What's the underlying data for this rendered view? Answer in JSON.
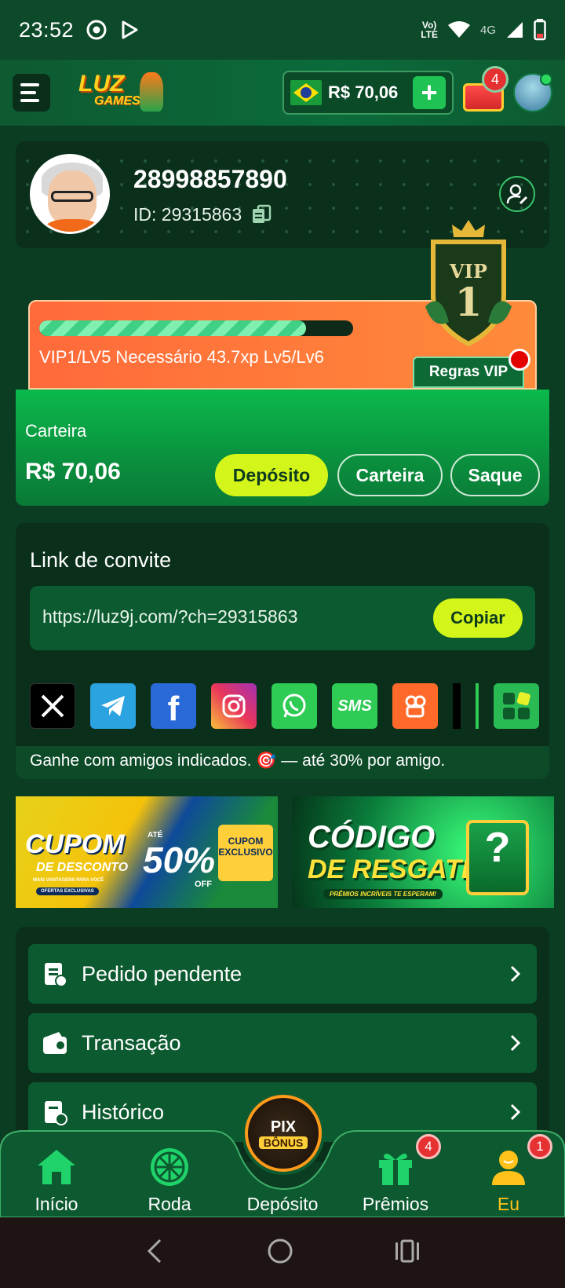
{
  "status_bar": {
    "time": "23:52",
    "net_label": "Vo)\nLTE",
    "net_type": "4G",
    "icons": [
      "chrome-icon",
      "play-store-icon",
      "volte-icon",
      "wifi-icon",
      "signal-icon",
      "battery-icon"
    ]
  },
  "header": {
    "logo_line1": "LUZ",
    "logo_line2": "GAMES",
    "balance": "R$ 70,06",
    "plus": "+",
    "chest_badge": "4",
    "flag": "brazil-flag"
  },
  "profile": {
    "username": "28998857890",
    "user_id": "ID: 29315863"
  },
  "vip": {
    "progress_fraction": 0.85,
    "level_text": "VIP1/LV5  Necessário 43.7xp Lv5/Lv6",
    "badge_label": "VIP",
    "badge_level": "1",
    "rules_label": "Regras VIP"
  },
  "wallet": {
    "label": "Carteira",
    "amount": "R$ 70,06",
    "deposit_label": "Depósito",
    "wallet_label": "Carteira",
    "withdraw_label": "Saque"
  },
  "invite": {
    "title": "Link de convite",
    "link": "https://luz9j.com/?ch=29315863",
    "copy_label": "Copiar",
    "social": [
      {
        "name": "x-icon",
        "label": "X"
      },
      {
        "name": "telegram-icon",
        "label": ""
      },
      {
        "name": "facebook-icon",
        "label": "f"
      },
      {
        "name": "instagram-icon",
        "label": ""
      },
      {
        "name": "whatsapp-icon",
        "label": ""
      },
      {
        "name": "sms-icon",
        "label": "SMS"
      },
      {
        "name": "kwai-icon",
        "label": ""
      },
      {
        "name": "tiktok-icon",
        "label": ""
      },
      {
        "name": "line-icon",
        "label": ""
      },
      {
        "name": "more-apps-icon",
        "label": ""
      }
    ],
    "note": "Ganhe com amigos indicados. 🎯 — até 30% por amigo."
  },
  "banners": {
    "coupon": {
      "title": "CUPOM",
      "subtitle": "DE DESCONTO",
      "until": "ATÉ",
      "pct": "50%",
      "off": "OFF",
      "exclusive": "CUPOM EXCLUSIVO",
      "tag1": "MAIS VANTAGENS PARA VOCÊ",
      "tag2": "OFERTAS EXCLUSIVAS"
    },
    "redeem": {
      "title": "CÓDIGO",
      "subtitle": "DE RESGATE",
      "tag": "PRÊMIOS INCRÍVEIS TE ESPERAM!"
    }
  },
  "menu": {
    "items": [
      {
        "label": "Pedido pendente",
        "icon": "pending-order-icon"
      },
      {
        "label": "Transação",
        "icon": "wallet-transaction-icon"
      },
      {
        "label": "Histórico",
        "icon": "history-icon"
      }
    ]
  },
  "bottom_nav": {
    "items": [
      {
        "label": "Início",
        "icon": "home-icon"
      },
      {
        "label": "Roda",
        "icon": "wheel-icon"
      },
      {
        "label": "Depósito",
        "icon": "pix-bonus-icon"
      },
      {
        "label": "Prêmios",
        "icon": "gift-icon",
        "badge": "4"
      },
      {
        "label": "Eu",
        "icon": "user-icon",
        "badge": "1"
      }
    ],
    "center_pix": "PIX",
    "center_bonus": "BÔNUS",
    "active_color": "#ffc21a"
  },
  "colors": {
    "accent_lime": "#d4f51a",
    "brand_green": "#0bb94c",
    "vip_orange": "#ff6a3a"
  }
}
